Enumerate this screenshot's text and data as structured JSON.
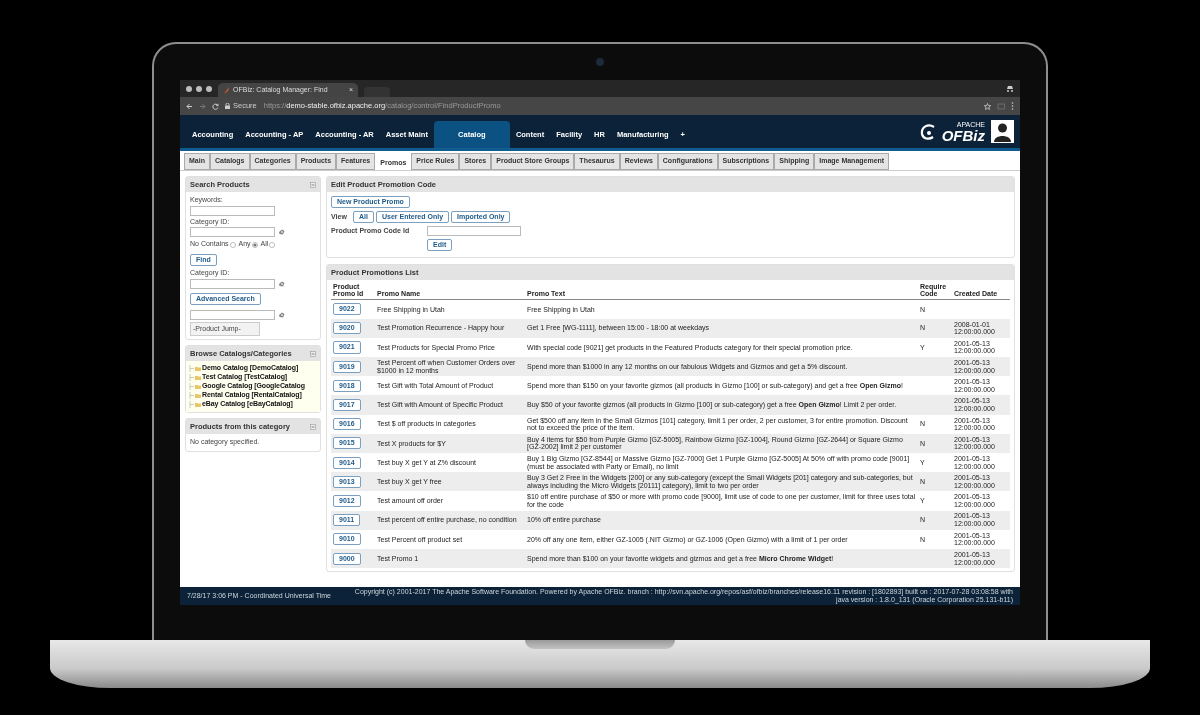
{
  "browser": {
    "tab_title": "OFBiz: Catalog Manager: Find",
    "tab_close": "×",
    "secure_label": "Secure",
    "url_scheme": "https://",
    "url_host": "demo-stable.ofbiz.apache.org",
    "url_path": "/catalog/control/FindProductPromo"
  },
  "app_nav": [
    {
      "label": "Accounting",
      "selected": false
    },
    {
      "label": "Accounting - AP",
      "selected": false
    },
    {
      "label": "Accounting - AR",
      "selected": false
    },
    {
      "label": "Asset Maint",
      "selected": false
    },
    {
      "label": "Catalog",
      "selected": true
    },
    {
      "label": "Content",
      "selected": false
    },
    {
      "label": "Facility",
      "selected": false
    },
    {
      "label": "HR",
      "selected": false
    },
    {
      "label": "Manufacturing",
      "selected": false
    },
    {
      "label": "+",
      "selected": false
    }
  ],
  "logo": {
    "small": "APACHE",
    "main": "OFBiz"
  },
  "sub_tabs": [
    {
      "label": "Main",
      "selected": false
    },
    {
      "label": "Catalogs",
      "selected": false
    },
    {
      "label": "Categories",
      "selected": false
    },
    {
      "label": "Products",
      "selected": false
    },
    {
      "label": "Features",
      "selected": false
    },
    {
      "label": "Promos",
      "selected": true
    },
    {
      "label": "Price Rules",
      "selected": false
    },
    {
      "label": "Stores",
      "selected": false
    },
    {
      "label": "Product Store Groups",
      "selected": false
    },
    {
      "label": "Thesaurus",
      "selected": false
    },
    {
      "label": "Reviews",
      "selected": false
    },
    {
      "label": "Configurations",
      "selected": false
    },
    {
      "label": "Subscriptions",
      "selected": false
    },
    {
      "label": "Shipping",
      "selected": false
    },
    {
      "label": "Image Management",
      "selected": false
    }
  ],
  "search_panel": {
    "title": "Search Products",
    "keywords_label": "Keywords:",
    "category_label": "Category ID:",
    "match_options": [
      {
        "label": "No Contains",
        "selected": false
      },
      {
        "label": "Any",
        "selected": true
      },
      {
        "label": "All",
        "selected": false
      }
    ],
    "find_button": "Find",
    "category_label_2": "Category ID:",
    "advanced_button": "Advanced Search",
    "jump_select": "-Product Jump-"
  },
  "browse_panel": {
    "title": "Browse Catalogs/Categories",
    "items": [
      "Demo Catalog [DemoCatalog]",
      "Test Catalog [TestCatalog]",
      "Google Catalog [GoogleCatalog",
      "Rental Catalog [RentalCatalog]",
      "eBay Catalog [eBayCatalog]"
    ]
  },
  "category_panel": {
    "title": "Products from this category",
    "message": "No category specified."
  },
  "edit_panel": {
    "title": "Edit Product Promotion Code",
    "new_button": "New Product Promo",
    "view_label": "View",
    "view_buttons": [
      "All",
      "User Entered Only",
      "Imported Only"
    ],
    "code_label": "Product Promo Code Id",
    "edit_button": "Edit"
  },
  "list_panel": {
    "title": "Product Promotions List",
    "columns": [
      "Product Promo Id",
      "Promo Name",
      "Promo Text",
      "Require Code",
      "Created Date"
    ],
    "rows": [
      {
        "id": "9022",
        "name": "Free Shipping in Utah",
        "text": "Free Shipping in Utah",
        "require_code": "N"
      },
      {
        "id": "9020",
        "name": "Test Promotion Recurrence - Happy hour",
        "text": "Get 1 Free [WG-1111], between 15:00 - 18:00 at weekdays",
        "require_code": "N",
        "created": "2008-01-01 12:00:00.000"
      },
      {
        "id": "9021",
        "name": "Test Products for Special Promo Price",
        "text": "With special code [9021] get products in the Featured Products category for their special promotion price.",
        "require_code": "Y",
        "created": "2001-05-13 12:00:00.000"
      },
      {
        "id": "9019",
        "name": "Test Percent off when Customer Orders over $1000 in 12 months",
        "text": "Spend more than $1000 in any 12 months on our fabulous Widgets and Gizmos and get a 5% discount.",
        "created": "2001-05-13 12:00:00.000"
      },
      {
        "id": "9018",
        "name": "Test Gift with Total Amount of Product",
        "text": "Spend more than $150 on your favorite gizmos (all products in Gizmo [100] or sub-category) and get a free **Open Gizmo**!",
        "created": "2001-05-13 12:00:00.000"
      },
      {
        "id": "9017",
        "name": "Test Gift with Amount of Specific Product",
        "text": "Buy $50 of your favorite gizmos (all products in Gizmo [100] or sub-category) get a free **Open Gizmo**! Limit 2 per order.",
        "created": "2001-05-13 12:00:00.000"
      },
      {
        "id": "9016",
        "name": "Test $ off products in categories",
        "text": "Get $500 off any item in the Small Gizmos [101] category, limit 1 per order, 2 per customer, 3 for entire promotion. Discount not to exceed the price of the item.",
        "require_code": "N",
        "created": "2001-05-13 12:00:00.000"
      },
      {
        "id": "9015",
        "name": "Test X products for $Y",
        "text": "Buy 4 items for $50 from Purple Gizmo [GZ-5005], Rainbow Gizmo [GZ-1004], Round Gizmo [GZ-2644] or Square Gizmo [GZ-2002] limit 2 per customer",
        "require_code": "N",
        "created": "2001-05-13 12:00:00.000"
      },
      {
        "id": "9014",
        "name": "Test buy X get Y at Z% discount",
        "text": "Buy 1 Big Gizmo [GZ-8544] or Massive Gizmo [GZ-7000] Get 1 Purple Gizmo [GZ-5005] At 50% off with promo code [9001] (must be associated with Party or Email), no limit",
        "require_code": "Y",
        "created": "2001-05-13 12:00:00.000"
      },
      {
        "id": "9013",
        "name": "Test buy X get Y free",
        "text": "Buy 3 Get 2 Free in the Widgets [200] or any sub-category (except the Small Widgets [201] category and sub-categories, but always including the Micro Widgets [20111] category), limit to two per order",
        "require_code": "N",
        "created": "2001-05-13 12:00:00.000"
      },
      {
        "id": "9012",
        "name": "Test amount off order",
        "text": "$10 off entire purchase of $50 or more with promo code [9000], limit use of code to one per customer, limit for three uses total for the code",
        "require_code": "Y",
        "created": "2001-05-13 12:00:00.000"
      },
      {
        "id": "9011",
        "name": "Test percent off entire purchase, no condition",
        "text": "10% off entire purchase",
        "require_code": "N",
        "created": "2001-05-13 12:00:00.000"
      },
      {
        "id": "9010",
        "name": "Test Percent off product set",
        "text": "20% off any one item, either GZ-1005 (.NIT Gizmo) or GZ-1006 (Open Gizmo) with a limit of 1 per order",
        "require_code": "N",
        "created": "2001-05-13 12:00:00.000"
      },
      {
        "id": "9000",
        "name": "Test Promo 1",
        "text": "Spend more than $100 on your favorite widgets and gizmos and get a free **Micro Chrome Widget**!",
        "created": "2001-05-13 12:00:00.000"
      }
    ]
  },
  "status_bar": {
    "left": "7/28/17 3:06 PM - Coordinated Universal Time",
    "right": "Copyright (c) 2001-2017 The Apache Software Foundation. Powered by Apache OFBiz. branch : http://svn.apache.org/repos/asf/ofbiz/branches/release16.11 revision : [1802893] built on : 2017-07-28 03:08:58 with java version : 1.8.0_131 (Oracle Corporation 25.131-b11)"
  }
}
